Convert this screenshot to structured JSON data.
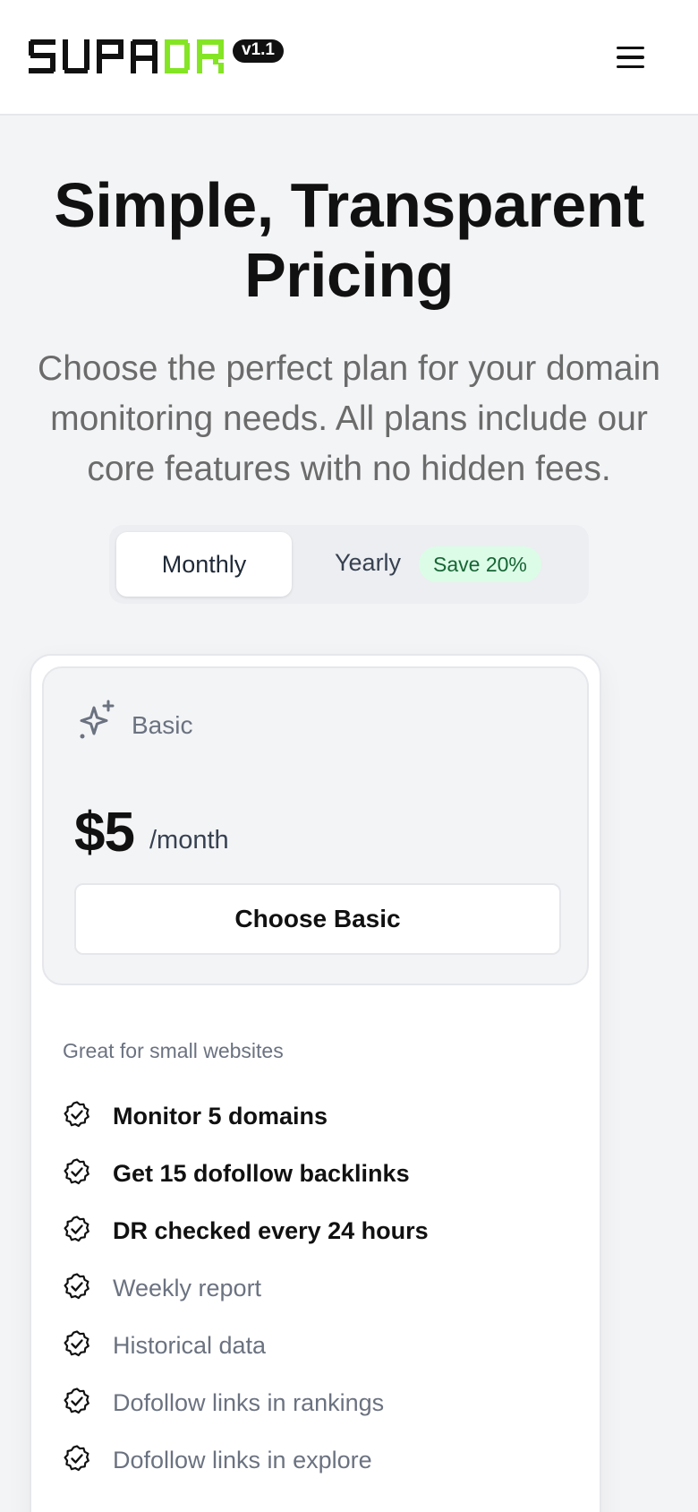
{
  "header": {
    "logo_text": "SUPADR",
    "version": "v1.1",
    "menu_icon": "hamburger-menu-icon",
    "brand_color": "#84e524"
  },
  "hero": {
    "title": "Simple, Transparent Pricing",
    "subtitle": "Choose the perfect plan for your domain monitoring needs. All plans include our core features with no hidden fees."
  },
  "billing": {
    "monthly": "Monthly",
    "yearly": "Yearly",
    "save_badge": "Save 20%",
    "selected": "Monthly"
  },
  "plan": {
    "icon": "sparkle-icon",
    "name": "Basic",
    "price": "$5",
    "period": "/month",
    "cta": "Choose Basic",
    "description": "Great for small websites",
    "features": [
      {
        "text": "Monitor 5 domains",
        "highlight": true
      },
      {
        "text": "Get 15 dofollow backlinks",
        "highlight": true
      },
      {
        "text": "DR checked every 24 hours",
        "highlight": true
      },
      {
        "text": "Weekly report",
        "highlight": false
      },
      {
        "text": "Historical data",
        "highlight": false
      },
      {
        "text": "Dofollow links in rankings",
        "highlight": false
      },
      {
        "text": "Dofollow links in explore",
        "highlight": false
      }
    ]
  }
}
